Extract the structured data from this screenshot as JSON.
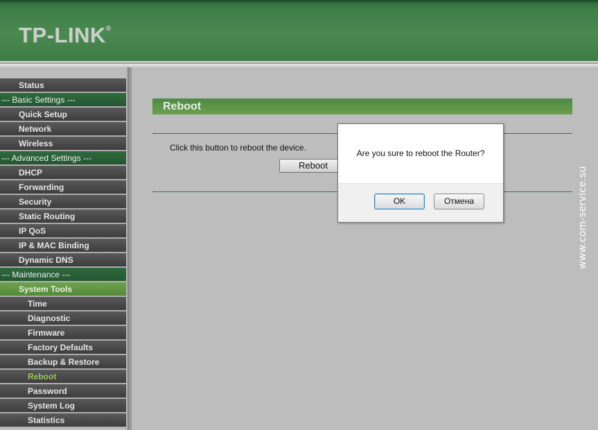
{
  "header": {
    "logo": "TP-LINK",
    "logo_mark": "®"
  },
  "sidebar": {
    "items": [
      {
        "label": "Status",
        "kind": "item"
      },
      {
        "label": "--- Basic Settings ---",
        "kind": "section"
      },
      {
        "label": "Quick Setup",
        "kind": "item"
      },
      {
        "label": "Network",
        "kind": "item"
      },
      {
        "label": "Wireless",
        "kind": "item"
      },
      {
        "label": "--- Advanced Settings ---",
        "kind": "section"
      },
      {
        "label": "DHCP",
        "kind": "item"
      },
      {
        "label": "Forwarding",
        "kind": "item"
      },
      {
        "label": "Security",
        "kind": "item"
      },
      {
        "label": "Static Routing",
        "kind": "item"
      },
      {
        "label": "IP QoS",
        "kind": "item"
      },
      {
        "label": "IP & MAC Binding",
        "kind": "item"
      },
      {
        "label": "Dynamic DNS",
        "kind": "item"
      },
      {
        "label": "--- Maintenance ---",
        "kind": "section"
      },
      {
        "label": "System Tools",
        "kind": "item",
        "state": "expanded"
      },
      {
        "label": "Time",
        "kind": "subitem"
      },
      {
        "label": "Diagnostic",
        "kind": "subitem"
      },
      {
        "label": "Firmware",
        "kind": "subitem"
      },
      {
        "label": "Factory Defaults",
        "kind": "subitem"
      },
      {
        "label": "Backup & Restore",
        "kind": "subitem"
      },
      {
        "label": "Reboot",
        "kind": "subitem",
        "state": "selected"
      },
      {
        "label": "Password",
        "kind": "subitem"
      },
      {
        "label": "System Log",
        "kind": "subitem"
      },
      {
        "label": "Statistics",
        "kind": "subitem"
      }
    ]
  },
  "main": {
    "title": "Reboot",
    "instruction": "Click this button to reboot the device.",
    "reboot_button": "Reboot"
  },
  "dialog": {
    "message": "Are you sure to reboot the Router?",
    "ok_label": "OK",
    "cancel_label": "Отмена"
  },
  "watermark": "www.com-service.su",
  "colors": {
    "header_green": "#3d7d47",
    "section_green": "#2f6a3e",
    "title_green": "#5a9448",
    "selected_text": "#9bc35a"
  }
}
